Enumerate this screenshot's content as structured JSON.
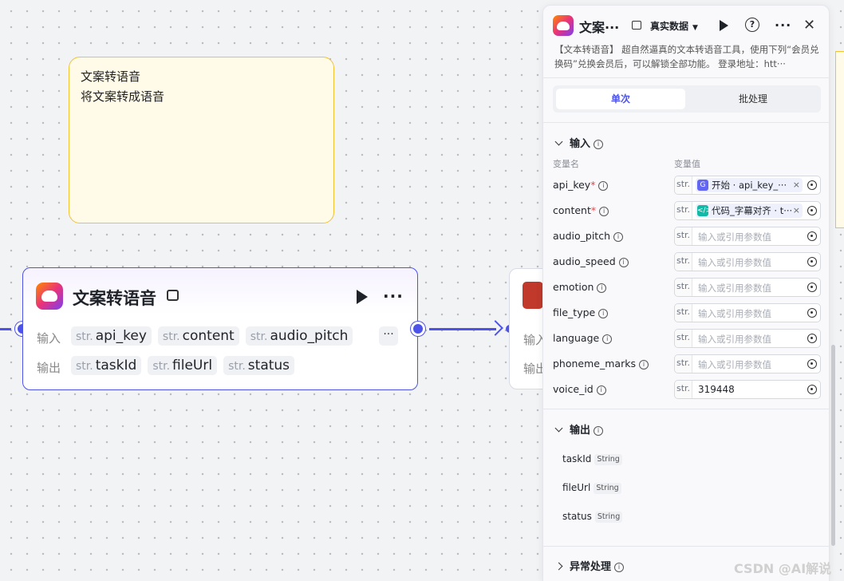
{
  "note": {
    "line1": "文案转语音",
    "line2": "将文案转成语音"
  },
  "node": {
    "title": "文案转语音",
    "input_label": "输入",
    "output_label": "输出",
    "type_prefix": "str.",
    "inputs": [
      "api_key",
      "content",
      "audio_pitch"
    ],
    "outputs": [
      "taskId",
      "fileUrl",
      "status"
    ],
    "more_symbol": "···"
  },
  "node2": {
    "input_label": "输入",
    "output_label": "输出"
  },
  "panel": {
    "title": "文案···",
    "data_mode": "真实数据",
    "description": "【文本转语音】 超自然逼真的文本转语音工具，使用下列“会员兑换码”兑换会员后，可以解锁全部功能。 登录地址：htt···",
    "tabs": [
      "单次",
      "批处理"
    ],
    "input_section": "输入",
    "col_name": "变量名",
    "col_value": "变量值",
    "variables": [
      {
        "name": "api_key",
        "required": true,
        "ref_text": "开始 · api_key_···",
        "ref_color": "#6366f1",
        "ref_icon": "G"
      },
      {
        "name": "content",
        "required": true,
        "ref_text": "代码_字幕对齐 · t···",
        "ref_color": "#14b8a6",
        "ref_icon": "</>"
      },
      {
        "name": "audio_pitch",
        "required": false,
        "placeholder": "输入或引用参数值"
      },
      {
        "name": "audio_speed",
        "required": false,
        "placeholder": "输入或引用参数值"
      },
      {
        "name": "emotion",
        "required": false,
        "placeholder": "输入或引用参数值"
      },
      {
        "name": "file_type",
        "required": false,
        "placeholder": "输入或引用参数值"
      },
      {
        "name": "language",
        "required": false,
        "placeholder": "输入或引用参数值"
      },
      {
        "name": "phoneme_marks",
        "required": false,
        "placeholder": "输入或引用参数值"
      },
      {
        "name": "voice_id",
        "required": false,
        "value": "319448"
      }
    ],
    "output_section": "输出",
    "outputs": [
      {
        "name": "taskId",
        "type": "String"
      },
      {
        "name": "fileUrl",
        "type": "String"
      },
      {
        "name": "status",
        "type": "String"
      }
    ],
    "error_section": "异常处理"
  },
  "watermark": "CSDN @AI解说",
  "colors": {
    "accent": "#4d53e8",
    "note_bg": "#fffbe8",
    "note_border": "#f1c232"
  }
}
